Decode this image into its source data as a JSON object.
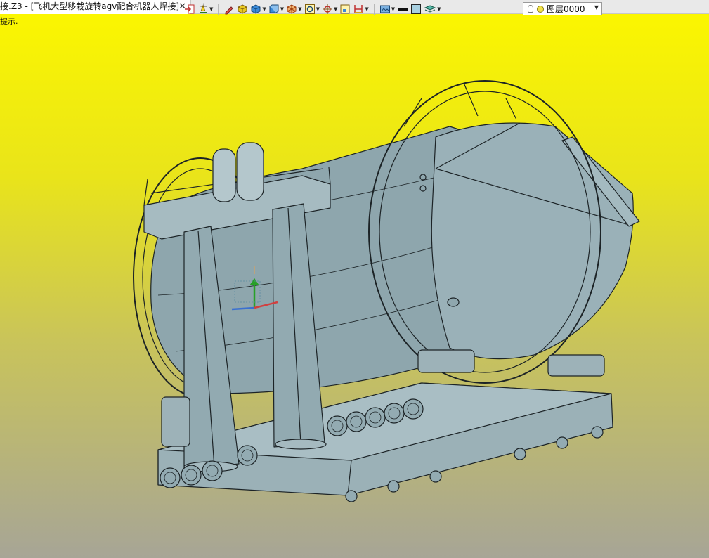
{
  "tab": {
    "title": "接.Z3 - [飞机大型移栽旋转agv配合机器人焊接]",
    "close_glyph": "✕",
    "new_tab_glyph": "+"
  },
  "status": {
    "prompt": "提示."
  },
  "toolbar": {
    "layer_name": "图层0000"
  },
  "colors": {
    "viewport_top": "#fbf600",
    "viewport_bottom": "#a7a596",
    "model_fill": "#8fa7ae",
    "model_edge": "#1c2326",
    "axis_x": "#d04040",
    "axis_y": "#3a70d0",
    "axis_z": "#28a028"
  }
}
